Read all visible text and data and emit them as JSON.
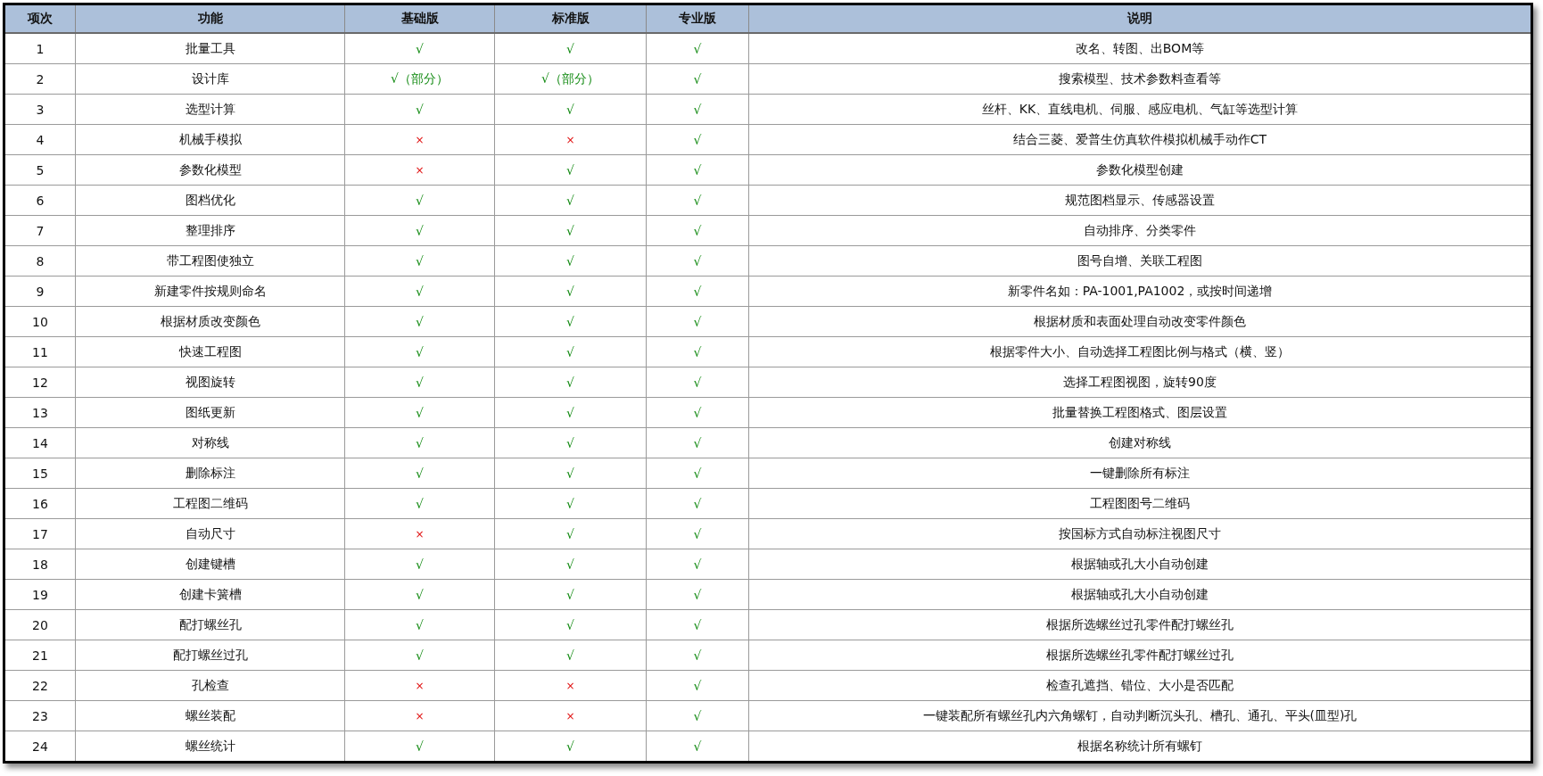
{
  "table": {
    "columns": [
      "项次",
      "功能",
      "基础版",
      "标准版",
      "专业版",
      "说明"
    ],
    "rows": [
      {
        "no": "1",
        "feature": "批量工具",
        "editions": [
          {
            "text": "√",
            "kind": "yes"
          },
          {
            "text": "√",
            "kind": "yes"
          },
          {
            "text": "√",
            "kind": "yes"
          }
        ],
        "description": "改名、转图、出BOM等"
      },
      {
        "no": "2",
        "feature": "设计库",
        "editions": [
          {
            "text": "√（部分）",
            "kind": "yes"
          },
          {
            "text": "√（部分）",
            "kind": "yes"
          },
          {
            "text": "√",
            "kind": "yes"
          }
        ],
        "description": "搜索模型、技术参数料查看等"
      },
      {
        "no": "3",
        "feature": "选型计算",
        "editions": [
          {
            "text": "√",
            "kind": "yes"
          },
          {
            "text": "√",
            "kind": "yes"
          },
          {
            "text": "√",
            "kind": "yes"
          }
        ],
        "description": "丝杆、KK、直线电机、伺服、感应电机、气缸等选型计算"
      },
      {
        "no": "4",
        "feature": "机械手模拟",
        "editions": [
          {
            "text": "×",
            "kind": "no"
          },
          {
            "text": "×",
            "kind": "no"
          },
          {
            "text": "√",
            "kind": "yes"
          }
        ],
        "description": "结合三菱、爱普生仿真软件模拟机械手动作CT"
      },
      {
        "no": "5",
        "feature": "参数化模型",
        "editions": [
          {
            "text": "×",
            "kind": "no"
          },
          {
            "text": "√",
            "kind": "yes"
          },
          {
            "text": "√",
            "kind": "yes"
          }
        ],
        "description": "参数化模型创建"
      },
      {
        "no": "6",
        "feature": "图档优化",
        "editions": [
          {
            "text": "√",
            "kind": "yes"
          },
          {
            "text": "√",
            "kind": "yes"
          },
          {
            "text": "√",
            "kind": "yes"
          }
        ],
        "description": "规范图档显示、传感器设置"
      },
      {
        "no": "7",
        "feature": "整理排序",
        "editions": [
          {
            "text": "√",
            "kind": "yes"
          },
          {
            "text": "√",
            "kind": "yes"
          },
          {
            "text": "√",
            "kind": "yes"
          }
        ],
        "description": "自动排序、分类零件"
      },
      {
        "no": "8",
        "feature": "带工程图使独立",
        "editions": [
          {
            "text": "√",
            "kind": "yes"
          },
          {
            "text": "√",
            "kind": "yes"
          },
          {
            "text": "√",
            "kind": "yes"
          }
        ],
        "description": "图号自增、关联工程图"
      },
      {
        "no": "9",
        "feature": "新建零件按规则命名",
        "editions": [
          {
            "text": "√",
            "kind": "yes"
          },
          {
            "text": "√",
            "kind": "yes"
          },
          {
            "text": "√",
            "kind": "yes"
          }
        ],
        "description": "新零件名如：PA-1001,PA1002，或按时间递增"
      },
      {
        "no": "10",
        "feature": "根据材质改变颜色",
        "editions": [
          {
            "text": "√",
            "kind": "yes"
          },
          {
            "text": "√",
            "kind": "yes"
          },
          {
            "text": "√",
            "kind": "yes"
          }
        ],
        "description": "根据材质和表面处理自动改变零件颜色"
      },
      {
        "no": "11",
        "feature": "快速工程图",
        "editions": [
          {
            "text": "√",
            "kind": "yes"
          },
          {
            "text": "√",
            "kind": "yes"
          },
          {
            "text": "√",
            "kind": "yes"
          }
        ],
        "description": "根据零件大小、自动选择工程图比例与格式（横、竖）"
      },
      {
        "no": "12",
        "feature": "视图旋转",
        "editions": [
          {
            "text": "√",
            "kind": "yes"
          },
          {
            "text": "√",
            "kind": "yes"
          },
          {
            "text": "√",
            "kind": "yes"
          }
        ],
        "description": "选择工程图视图，旋转90度"
      },
      {
        "no": "13",
        "feature": "图纸更新",
        "editions": [
          {
            "text": "√",
            "kind": "yes"
          },
          {
            "text": "√",
            "kind": "yes"
          },
          {
            "text": "√",
            "kind": "yes"
          }
        ],
        "description": "批量替换工程图格式、图层设置"
      },
      {
        "no": "14",
        "feature": "对称线",
        "editions": [
          {
            "text": "√",
            "kind": "yes"
          },
          {
            "text": "√",
            "kind": "yes"
          },
          {
            "text": "√",
            "kind": "yes"
          }
        ],
        "description": "创建对称线"
      },
      {
        "no": "15",
        "feature": "删除标注",
        "editions": [
          {
            "text": "√",
            "kind": "yes"
          },
          {
            "text": "√",
            "kind": "yes"
          },
          {
            "text": "√",
            "kind": "yes"
          }
        ],
        "description": "一键删除所有标注"
      },
      {
        "no": "16",
        "feature": "工程图二维码",
        "editions": [
          {
            "text": "√",
            "kind": "yes"
          },
          {
            "text": "√",
            "kind": "yes"
          },
          {
            "text": "√",
            "kind": "yes"
          }
        ],
        "description": "工程图图号二维码"
      },
      {
        "no": "17",
        "feature": "自动尺寸",
        "editions": [
          {
            "text": "×",
            "kind": "no"
          },
          {
            "text": "√",
            "kind": "yes"
          },
          {
            "text": "√",
            "kind": "yes"
          }
        ],
        "description": "按国标方式自动标注视图尺寸"
      },
      {
        "no": "18",
        "feature": "创建键槽",
        "editions": [
          {
            "text": "√",
            "kind": "yes"
          },
          {
            "text": "√",
            "kind": "yes"
          },
          {
            "text": "√",
            "kind": "yes"
          }
        ],
        "description": "根据轴或孔大小自动创建"
      },
      {
        "no": "19",
        "feature": "创建卡簧槽",
        "editions": [
          {
            "text": "√",
            "kind": "yes"
          },
          {
            "text": "√",
            "kind": "yes"
          },
          {
            "text": "√",
            "kind": "yes"
          }
        ],
        "description": "根据轴或孔大小自动创建"
      },
      {
        "no": "20",
        "feature": "配打螺丝孔",
        "editions": [
          {
            "text": "√",
            "kind": "yes"
          },
          {
            "text": "√",
            "kind": "yes"
          },
          {
            "text": "√",
            "kind": "yes"
          }
        ],
        "description": "根据所选螺丝过孔零件配打螺丝孔"
      },
      {
        "no": "21",
        "feature": "配打螺丝过孔",
        "editions": [
          {
            "text": "√",
            "kind": "yes"
          },
          {
            "text": "√",
            "kind": "yes"
          },
          {
            "text": "√",
            "kind": "yes"
          }
        ],
        "description": "根据所选螺丝孔零件配打螺丝过孔"
      },
      {
        "no": "22",
        "feature": "孔检查",
        "editions": [
          {
            "text": "×",
            "kind": "no"
          },
          {
            "text": "×",
            "kind": "no"
          },
          {
            "text": "√",
            "kind": "yes"
          }
        ],
        "description": "检查孔遮挡、错位、大小是否匹配"
      },
      {
        "no": "23",
        "feature": "螺丝装配",
        "editions": [
          {
            "text": "×",
            "kind": "no"
          },
          {
            "text": "×",
            "kind": "no"
          },
          {
            "text": "√",
            "kind": "yes"
          }
        ],
        "description": "一键装配所有螺丝孔内六角螺钉，自动判断沉头孔、槽孔、通孔、平头(皿型)孔"
      },
      {
        "no": "24",
        "feature": "螺丝统计",
        "editions": [
          {
            "text": "√",
            "kind": "yes"
          },
          {
            "text": "√",
            "kind": "yes"
          },
          {
            "text": "√",
            "kind": "yes"
          }
        ],
        "description": "根据名称统计所有螺钉"
      }
    ]
  }
}
